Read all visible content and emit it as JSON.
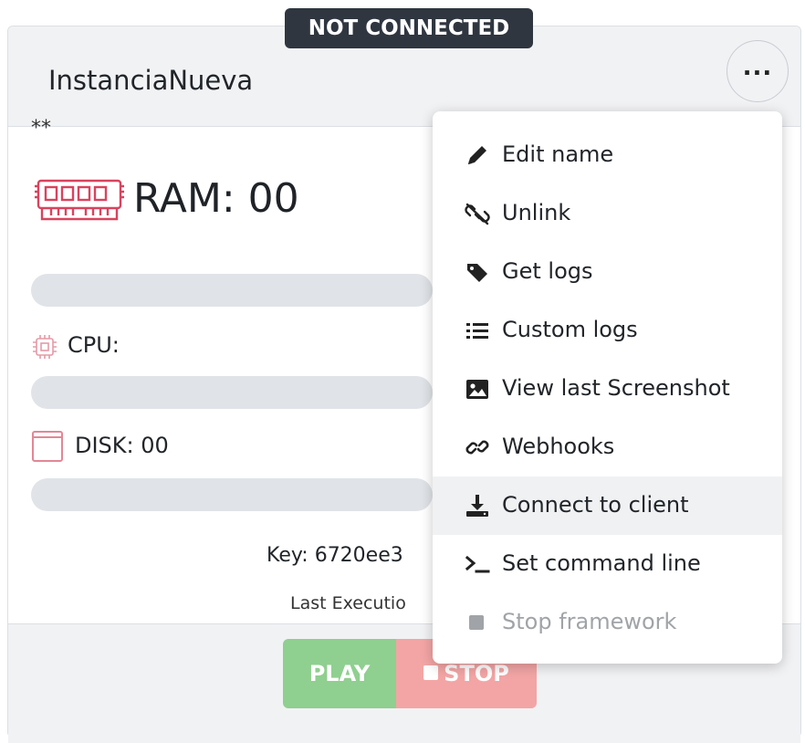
{
  "status": "NOT CONNECTED",
  "instance": {
    "name": "InstanciaNueva",
    "description": "**",
    "more_label": "..."
  },
  "resources": {
    "ram_label": "RAM: 00",
    "ram_percent": 0,
    "cpu_label": "CPU:",
    "cpu_percent": 0,
    "disk_label": "DISK: 00",
    "disk_percent": 0
  },
  "key_line": "Key: 6720ee3",
  "last_execution": "Last Executio",
  "actions": {
    "play_label": "PLAY",
    "stop_label": "STOP"
  },
  "menu": {
    "items": [
      {
        "label": "Edit name",
        "icon": "pencil-icon"
      },
      {
        "label": "Unlink",
        "icon": "unlink-icon"
      },
      {
        "label": "Get logs",
        "icon": "tag-icon"
      },
      {
        "label": "Custom logs",
        "icon": "list-icon"
      },
      {
        "label": "View last Screenshot",
        "icon": "image-icon"
      },
      {
        "label": "Webhooks",
        "icon": "link-icon"
      },
      {
        "label": "Connect to client",
        "icon": "download-icon",
        "hovered": true
      },
      {
        "label": "Set command line",
        "icon": "terminal-icon"
      },
      {
        "label": "Stop framework",
        "icon": "stop-square-icon",
        "disabled": true
      }
    ]
  },
  "colors": {
    "ram_icon": "#d9435e",
    "play": "#8fcf8f",
    "stop": "#f3a5a5",
    "status_bg": "#2f3640"
  }
}
